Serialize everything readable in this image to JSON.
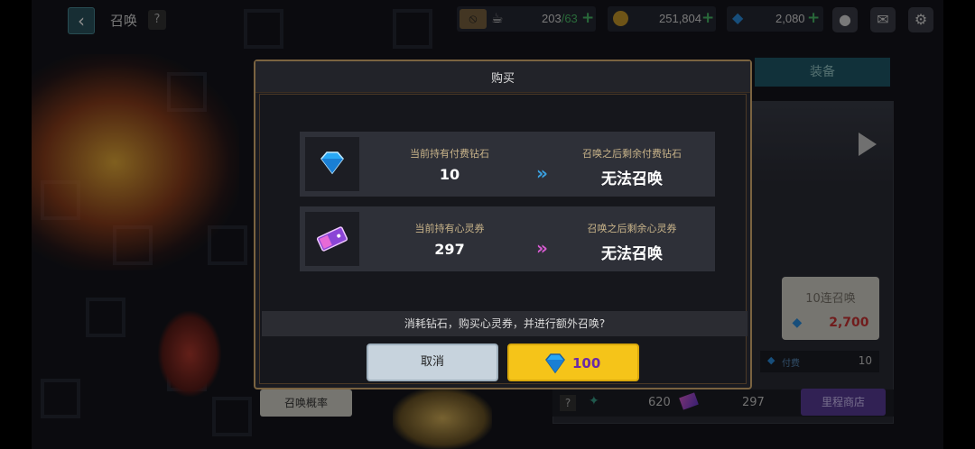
{
  "topbar": {
    "title": "召唤",
    "help": "?",
    "stamina": {
      "current": "203",
      "max": "/63"
    },
    "gold": "251,804",
    "gems": "2,080"
  },
  "right_panel": {
    "tab_label": "装备",
    "pull10_label": "10连召唤",
    "pull10_price": "2,700",
    "paid_label": "付费",
    "paid_count": "10",
    "stat_help": "?",
    "stat1": "620",
    "stat2": "297",
    "shop_button": "里程商店"
  },
  "left": {
    "rate_button": "召唤概率"
  },
  "modal": {
    "title": "购买",
    "rows": [
      {
        "icon": "diamond-icon",
        "have_label": "当前持有付费钻石",
        "have_value": "10",
        "after_label": "召唤之后剩余付费钻石",
        "after_value": "无法召唤",
        "arrow_color": "#3aa0e0"
      },
      {
        "icon": "ticket-icon",
        "have_label": "当前持有心灵券",
        "have_value": "297",
        "after_label": "召唤之后剩余心灵券",
        "after_value": "无法召唤",
        "arrow_color": "#d65bd0"
      }
    ],
    "arrow_glyph": "»",
    "question": "消耗钻石，购买心灵券，并进行额外召唤?",
    "cancel": "取消",
    "buy_price": "100"
  }
}
